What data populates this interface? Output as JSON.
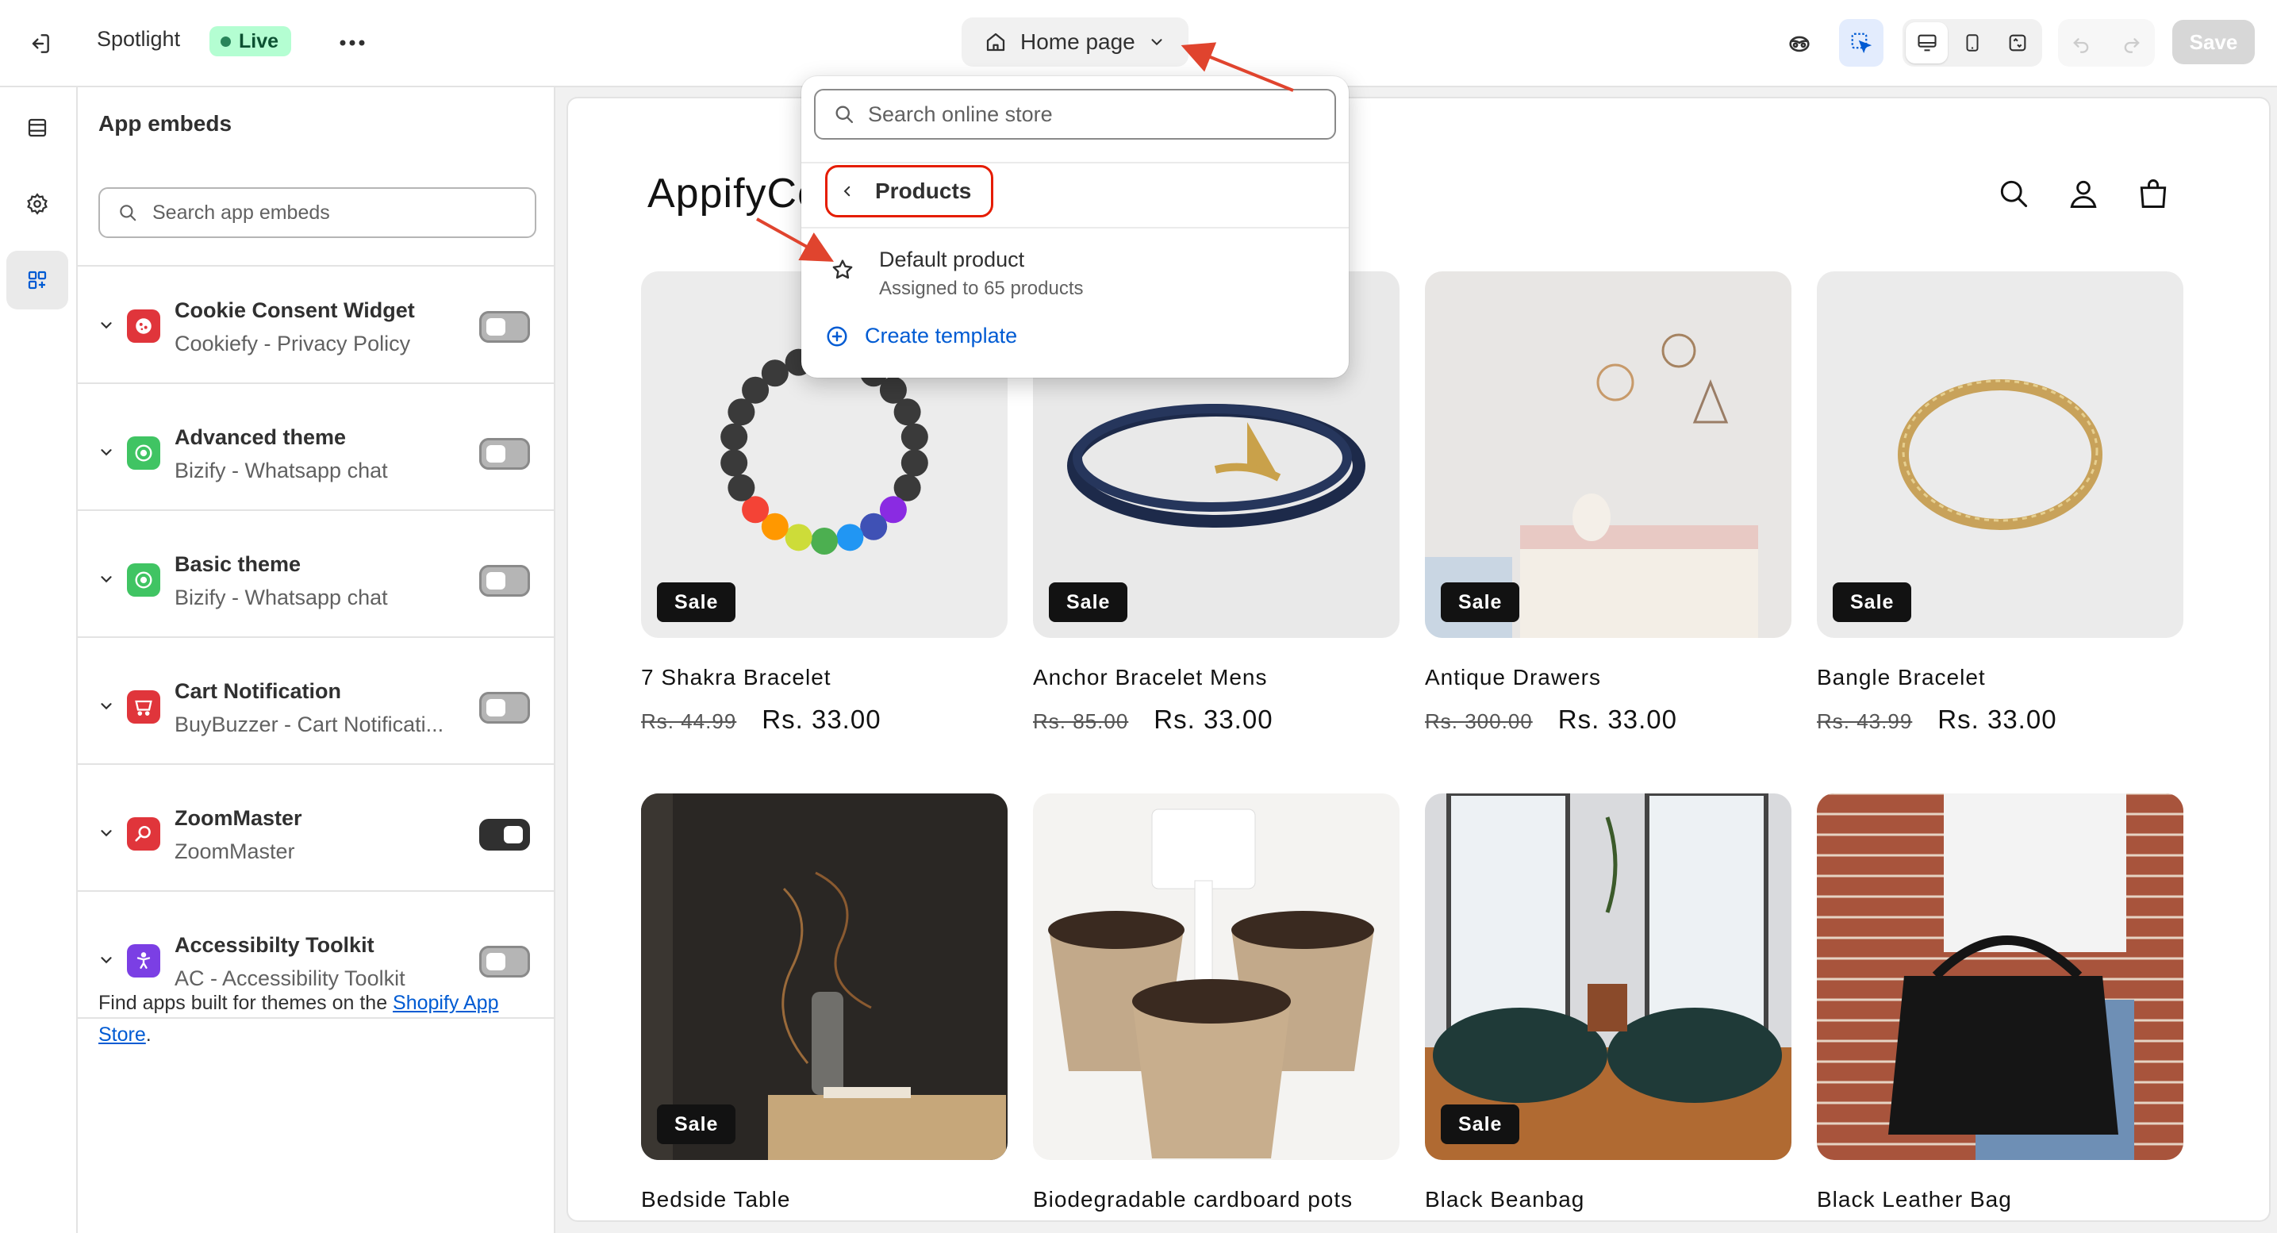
{
  "topbar": {
    "theme_name": "Spotlight",
    "live_badge": "Live",
    "page_selector": "Home page",
    "save_label": "Save"
  },
  "sidebar": {
    "title": "App embeds",
    "search_placeholder": "Search app embeds",
    "embeds": [
      {
        "name": "Cookie Consent Widget",
        "app": "Cookiefy - Privacy Policy",
        "enabled": false,
        "icon": "cookie-icon",
        "color": "#e0353b"
      },
      {
        "name": "Advanced theme",
        "app": "Bizify - Whatsapp chat",
        "enabled": false,
        "icon": "whatsapp-icon",
        "color": "#40c463"
      },
      {
        "name": "Basic theme",
        "app": "Bizify - Whatsapp chat",
        "enabled": false,
        "icon": "whatsapp-icon",
        "color": "#40c463"
      },
      {
        "name": "Cart Notification",
        "app": "BuyBuzzer - Cart Notificati...",
        "enabled": false,
        "icon": "cart-icon",
        "color": "#e0353b"
      },
      {
        "name": "ZoomMaster",
        "app": "ZoomMaster",
        "enabled": true,
        "icon": "zoom-icon",
        "color": "#e0353b"
      },
      {
        "name": "Accessibilty Toolkit",
        "app": "AC - Accessibility Toolkit",
        "enabled": false,
        "icon": "accessibility-icon",
        "color": "#7b3fe4"
      }
    ],
    "footer_text": "Find apps built for themes on the ",
    "footer_link": "Shopify App Store",
    "footer_end": "."
  },
  "dropdown": {
    "search_placeholder": "Search online store",
    "back_label": "Products",
    "item_title": "Default product",
    "item_subtitle": "Assigned to 65 products",
    "create_label": "Create template"
  },
  "store": {
    "name": "AppifyCo",
    "products": [
      {
        "title": "7 Shakra Bracelet",
        "was": "Rs. 44.99",
        "now": "Rs. 33.00",
        "sale": "Sale"
      },
      {
        "title": "Anchor Bracelet Mens",
        "was": "Rs. 85.00",
        "now": "Rs. 33.00",
        "sale": "Sale"
      },
      {
        "title": "Antique Drawers",
        "was": "Rs. 300.00",
        "now": "Rs. 33.00",
        "sale": "Sale"
      },
      {
        "title": "Bangle Bracelet",
        "was": "Rs. 43.99",
        "now": "Rs. 33.00",
        "sale": "Sale"
      },
      {
        "title": "Bedside Table",
        "sale": "Sale"
      },
      {
        "title": "Biodegradable cardboard pots",
        "sale": ""
      },
      {
        "title": "Black Beanbag",
        "sale": "Sale"
      },
      {
        "title": "Black Leather Bag",
        "sale": ""
      }
    ]
  }
}
